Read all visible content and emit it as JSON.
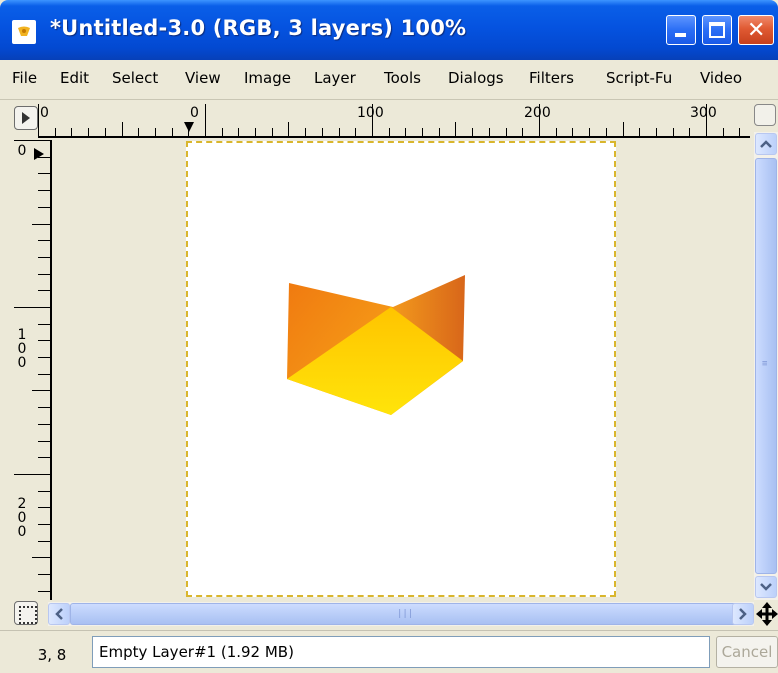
{
  "window": {
    "title": "*Untitled-3.0 (RGB, 3 layers) 100%",
    "title_bar_color": "#0553e0",
    "close_button_color": "#e05a33",
    "icons": [
      "gimp-wilber-icon",
      "minimize-icon",
      "maximize-icon",
      "close-icon"
    ]
  },
  "menu": {
    "items": [
      "File",
      "Edit",
      "Select",
      "View",
      "Image",
      "Layer",
      "Tools",
      "Dialogs",
      "Filters",
      "Script-Fu",
      "Video"
    ]
  },
  "rulers": {
    "horizontal_labels": [
      "0",
      "0",
      "100",
      "200",
      "300"
    ],
    "vertical_labels": [
      "0",
      "100",
      "200"
    ]
  },
  "canvas": {
    "background": "#ffffff",
    "selection_border_color": "#d9b62d",
    "shape_colors": [
      "#f5a300",
      "#ffd400",
      "#e86a10"
    ]
  },
  "status": {
    "coordinates": "3, 8",
    "layer_info": "Empty Layer#1 (1.92 MB)",
    "cancel_label": "Cancel"
  }
}
